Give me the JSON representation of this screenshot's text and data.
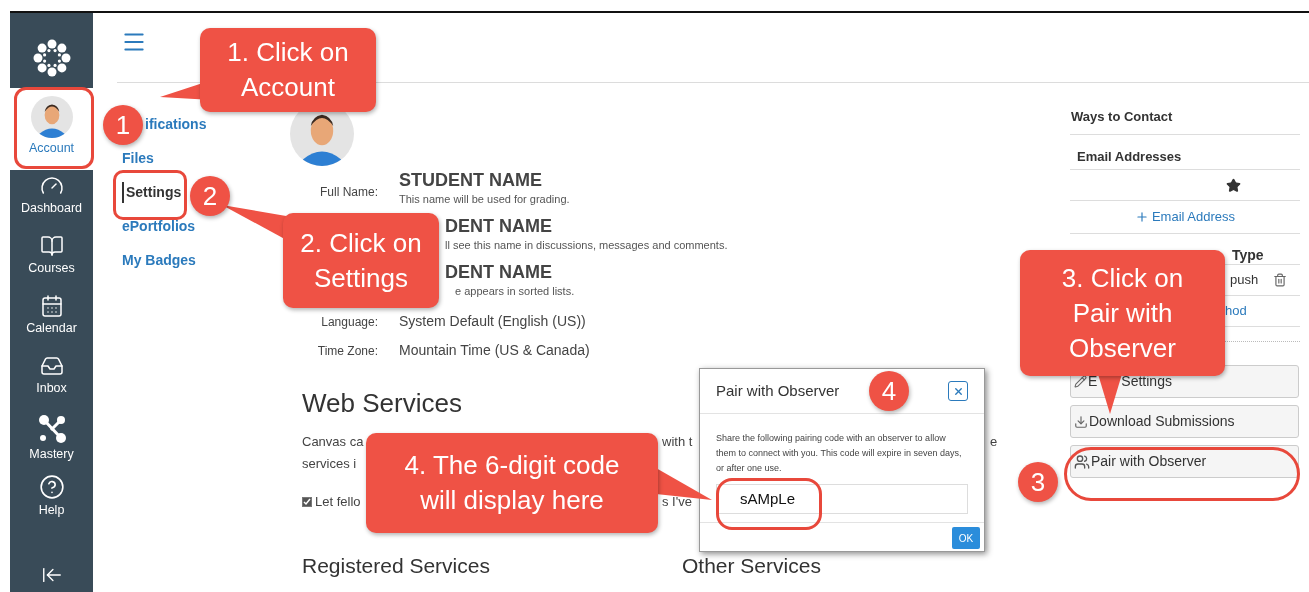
{
  "nav": {
    "items": [
      {
        "label": "Account",
        "selected": true
      },
      {
        "label": "Dashboard",
        "selected": false
      },
      {
        "label": "Courses",
        "selected": false
      },
      {
        "label": "Calendar",
        "selected": false
      },
      {
        "label": "Inbox",
        "selected": false
      },
      {
        "label": "Mastery",
        "selected": false
      },
      {
        "label": "Help",
        "selected": false
      }
    ]
  },
  "subnav": [
    {
      "label": "ifications",
      "selected": false
    },
    {
      "label": "Files",
      "selected": false
    },
    {
      "label": "Settings",
      "selected": true
    },
    {
      "label": "ePortfolios",
      "selected": false
    },
    {
      "label": "My Badges",
      "selected": false
    }
  ],
  "profile": {
    "names": [
      {
        "label": "Full Name:",
        "value": "STUDENT NAME",
        "hint": "This name will be used for grading."
      },
      {
        "value": "DENT NAME",
        "hint": "ll see this name in discussions, messages and comments."
      },
      {
        "value": "DENT NAME",
        "hint": "e appears in sorted lists."
      }
    ],
    "settings": [
      {
        "label": "Language:",
        "value": "System Default (English (US))"
      },
      {
        "label": "Time Zone:",
        "value": "Mountain Time (US & Canada)"
      }
    ]
  },
  "web_services": {
    "heading": "Web Services",
    "line_1": [
      "Canvas ca",
      "with t",
      "e"
    ],
    "line_2": [
      "services i"
    ],
    "checkbox": {
      "checked": true,
      "fragments": [
        "Let fello",
        "s I've"
      ]
    },
    "registered_heading": "Registered Services",
    "other_heading": "Other Services"
  },
  "contact": {
    "title": "Ways to Contact",
    "email_heading": "Email Addresses",
    "add_email": "Email Address",
    "type_heading": "Type",
    "type_value": "push",
    "method_fragment": "hod",
    "buttons": [
      {
        "kind": "edit",
        "parts": [
          "E",
          "Settings"
        ]
      },
      {
        "kind": "download",
        "parts": [
          "Download Submissions"
        ]
      },
      {
        "kind": "pair",
        "parts": [
          "Pair with Observer"
        ]
      }
    ]
  },
  "dialog": {
    "title": "Pair with Observer",
    "message": "Share the following pairing code with an observer to allow them to connect with you. This code will expire in seven days, or after one use.",
    "code": "sAMpLe",
    "ok": "OK"
  },
  "annotations": {
    "callouts": [
      {
        "lines": [
          "1. Click on",
          "Account"
        ]
      },
      {
        "lines": [
          "2. Click on",
          "Settings"
        ]
      },
      {
        "lines": [
          "3. Click on",
          "Pair with",
          "Observer"
        ]
      },
      {
        "lines": [
          "4. The 6-digit code",
          "will display here"
        ]
      }
    ],
    "markers": [
      "1",
      "2",
      "3",
      "4"
    ]
  }
}
